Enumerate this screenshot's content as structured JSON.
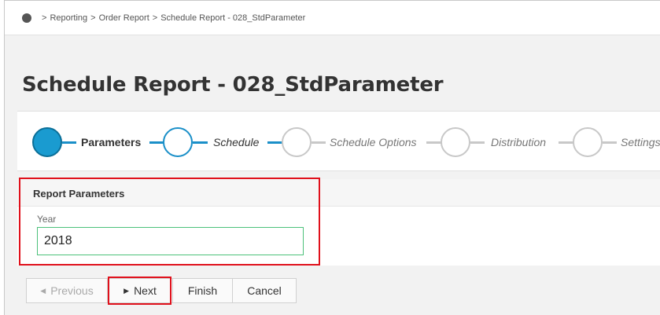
{
  "breadcrumb": {
    "items": [
      "Reporting",
      "Order Report",
      "Schedule Report - 028_StdParameter"
    ],
    "separator": ">"
  },
  "page_title": "Schedule Report - 028_StdParameter",
  "wizard": {
    "steps": [
      {
        "label": "Parameters",
        "state": "active"
      },
      {
        "label": "Schedule",
        "state": "next"
      },
      {
        "label": "Schedule Options",
        "state": "inactive"
      },
      {
        "label": "Distribution",
        "state": "inactive"
      },
      {
        "label": "Settings",
        "state": "inactive"
      }
    ],
    "colors": {
      "active_fill": "#1a9bd0",
      "active_border": "#0b6f98",
      "line_active": "#1a8fc8",
      "line_inactive": "#c8c8c8"
    }
  },
  "report_parameters": {
    "title": "Report Parameters",
    "fields": [
      {
        "label": "Year",
        "value": "2018"
      }
    ]
  },
  "buttons": {
    "previous": "Previous",
    "next": "Next",
    "finish": "Finish",
    "cancel": "Cancel"
  },
  "highlight_color": "#e0101b"
}
